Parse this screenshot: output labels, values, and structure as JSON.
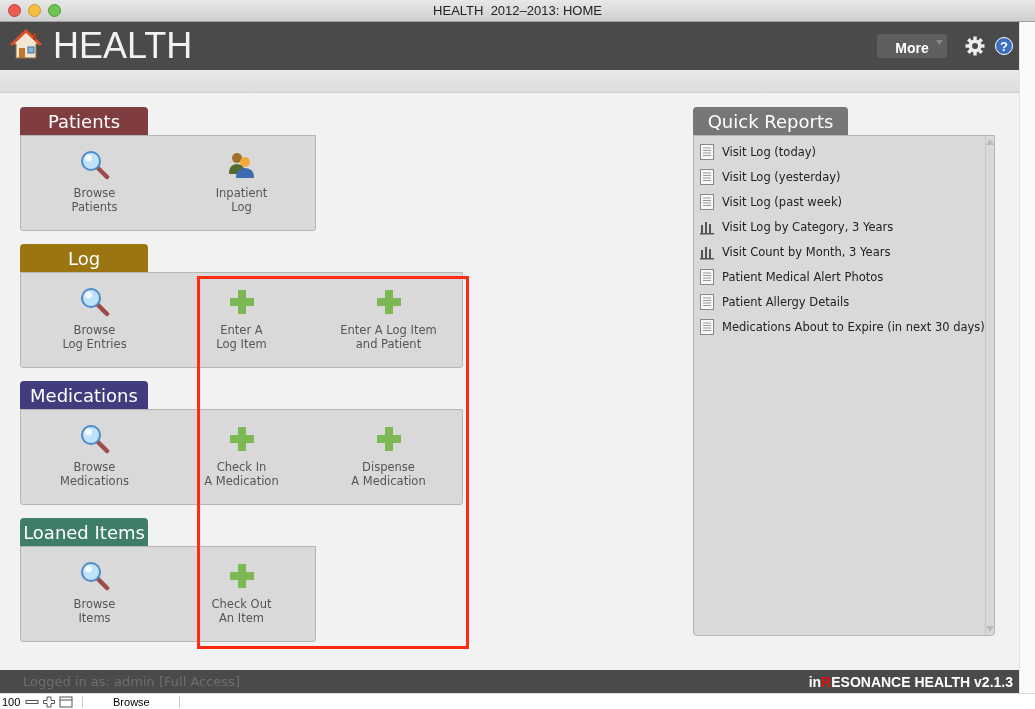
{
  "window": {
    "title": "HEALTH  2012–2013: HOME"
  },
  "header": {
    "title": "HEALTH",
    "more_button": "More",
    "help_label": "?"
  },
  "sections": [
    {
      "title": "Patients",
      "color": "#7f3d3f",
      "items": [
        {
          "kind": "browse",
          "label": "Browse\nPatients"
        },
        {
          "kind": "people",
          "label": "Inpatient\nLog"
        }
      ]
    },
    {
      "title": "Log",
      "color": "#9a7510",
      "items": [
        {
          "kind": "browse",
          "label": "Browse\nLog Entries"
        },
        {
          "kind": "add",
          "label": "Enter A\nLog Item"
        },
        {
          "kind": "add",
          "label": "Enter A Log Item\nand Patient"
        }
      ]
    },
    {
      "title": "Medications",
      "color": "#413c7e",
      "items": [
        {
          "kind": "browse",
          "label": "Browse\nMedications"
        },
        {
          "kind": "add",
          "label": "Check In\nA Medication"
        },
        {
          "kind": "add",
          "label": "Dispense\nA Medication"
        }
      ]
    },
    {
      "title": "Loaned Items",
      "color": "#3e7d66",
      "items": [
        {
          "kind": "browse",
          "label": "Browse\nItems"
        },
        {
          "kind": "add",
          "label": "Check Out\nAn Item"
        }
      ]
    }
  ],
  "quick_reports": {
    "title": "Quick Reports",
    "items": [
      {
        "kind": "document",
        "label": "Visit Log (today)"
      },
      {
        "kind": "document",
        "label": "Visit Log (yesterday)"
      },
      {
        "kind": "document",
        "label": "Visit Log (past week)"
      },
      {
        "kind": "chart",
        "label": "Visit Log by Category, 3 Years"
      },
      {
        "kind": "chart",
        "label": "Visit Count by Month, 3 Years"
      },
      {
        "kind": "document",
        "label": "Patient Medical Alert Photos"
      },
      {
        "kind": "document",
        "label": "Patient Allergy Details"
      },
      {
        "kind": "document",
        "label": "Medications About to Expire (in next 30 days)"
      }
    ]
  },
  "footer": {
    "login": "Logged in as: admin [Full Access]",
    "brand_prefix": "in",
    "brand_accent": "R",
    "brand_rest": "ESONANCE HEALTH v2.1.3"
  },
  "status_bar": {
    "zoom": "100",
    "mode": "Browse"
  }
}
